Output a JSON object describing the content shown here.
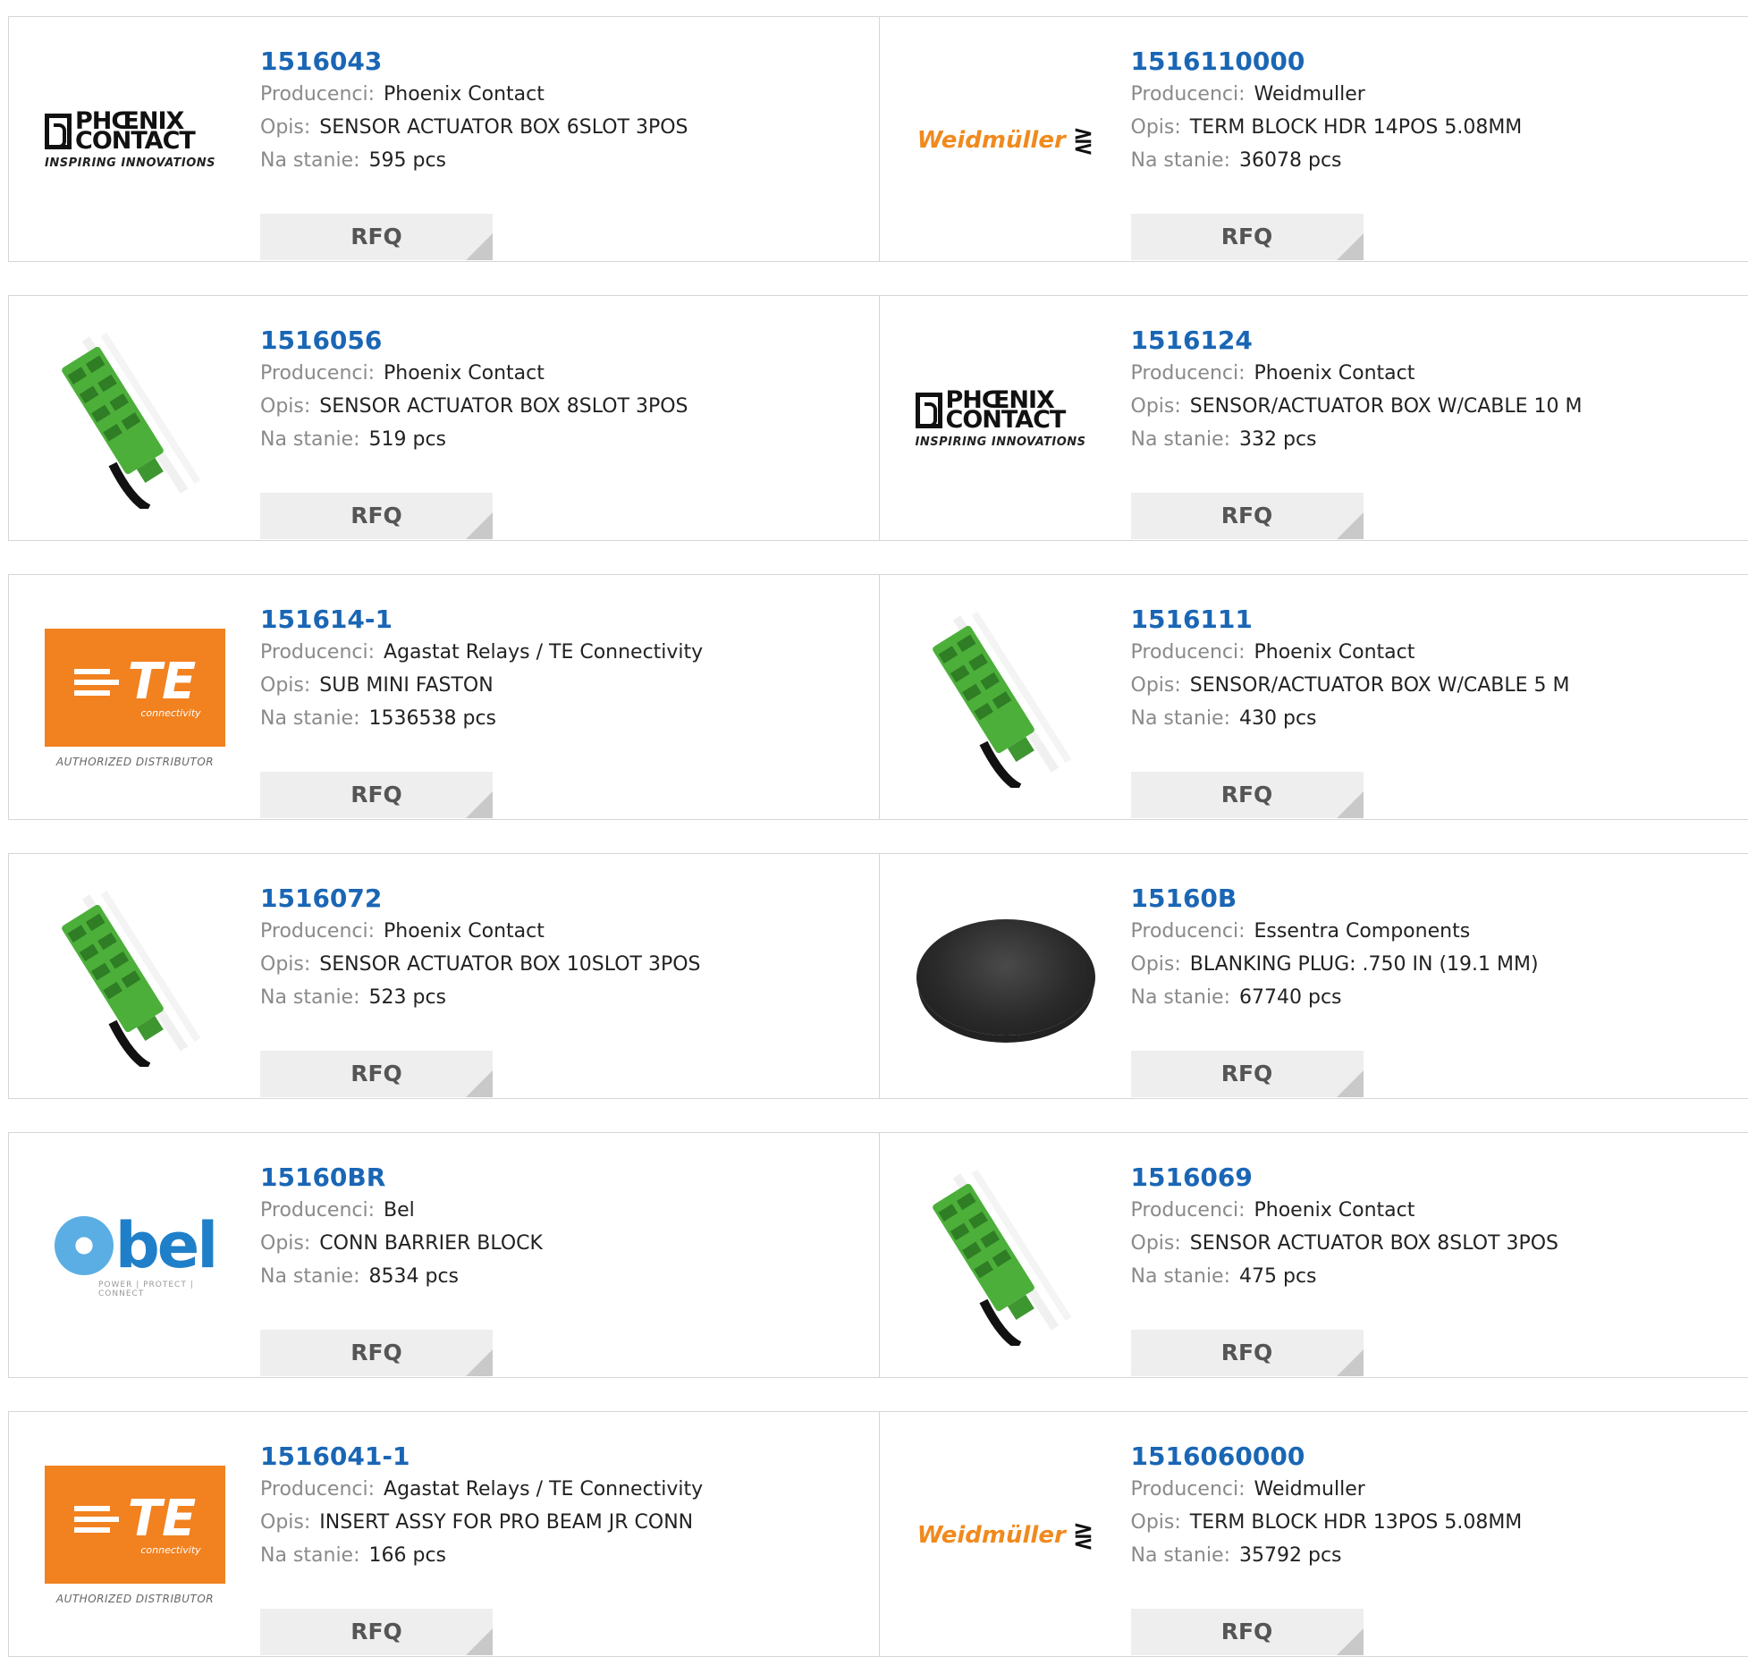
{
  "labels": {
    "manufacturer": "Producenci:",
    "description": "Opis:",
    "stock": "Na stanie:",
    "rfq": "RFQ"
  },
  "products": [
    {
      "part": "1516043",
      "manufacturer": "Phoenix Contact",
      "description": "SENSOR ACTUATOR BOX 6SLOT 3POS",
      "stock": "595 pcs",
      "logo": "phoenix-contact-logo"
    },
    {
      "part": "1516110000",
      "manufacturer": "Weidmuller",
      "description": "TERM BLOCK HDR 14POS 5.08MM",
      "stock": "36078 pcs",
      "logo": "weidmuller-logo"
    },
    {
      "part": "1516056",
      "manufacturer": "Phoenix Contact",
      "description": "SENSOR ACTUATOR BOX 8SLOT 3POS",
      "stock": "519 pcs",
      "logo": "sensor-box-photo"
    },
    {
      "part": "1516124",
      "manufacturer": "Phoenix Contact",
      "description": "SENSOR/ACTUATOR BOX W/CABLE 10 M",
      "stock": "332 pcs",
      "logo": "phoenix-contact-logo"
    },
    {
      "part": "151614-1",
      "manufacturer": "Agastat Relays / TE Connectivity",
      "description": "SUB MINI FASTON",
      "stock": "1536538 pcs",
      "logo": "te-connectivity-logo"
    },
    {
      "part": "1516111",
      "manufacturer": "Phoenix Contact",
      "description": "SENSOR/ACTUATOR BOX W/CABLE 5 M",
      "stock": "430 pcs",
      "logo": "sensor-box-photo"
    },
    {
      "part": "1516072",
      "manufacturer": "Phoenix Contact",
      "description": "SENSOR ACTUATOR BOX 10SLOT 3POS",
      "stock": "523 pcs",
      "logo": "sensor-box-photo"
    },
    {
      "part": "15160B",
      "manufacturer": "Essentra Components",
      "description": "BLANKING PLUG: .750 IN (19.1 MM)",
      "stock": "67740 pcs",
      "logo": "blanking-plug-photo"
    },
    {
      "part": "15160BR",
      "manufacturer": "Bel",
      "description": "CONN BARRIER BLOCK",
      "stock": "8534 pcs",
      "logo": "bel-logo"
    },
    {
      "part": "1516069",
      "manufacturer": "Phoenix Contact",
      "description": "SENSOR ACTUATOR BOX 8SLOT 3POS",
      "stock": "475 pcs",
      "logo": "sensor-box-photo"
    },
    {
      "part": "1516041-1",
      "manufacturer": "Agastat Relays / TE Connectivity",
      "description": "INSERT ASSY FOR PRO BEAM JR CONN",
      "stock": "166 pcs",
      "logo": "te-connectivity-logo"
    },
    {
      "part": "1516060000",
      "manufacturer": "Weidmuller",
      "description": "TERM BLOCK HDR 13POS 5.08MM",
      "stock": "35792 pcs",
      "logo": "weidmuller-logo"
    }
  ],
  "logos": {
    "phoenix": {
      "line1": "PHŒNIX",
      "line2": "CONTACT",
      "tagline": "INSPIRING INNOVATIONS"
    },
    "weidmuller": {
      "text": "Weidmüller",
      "symbol": "⋛"
    },
    "te": {
      "text": "TE",
      "sub": "connectivity",
      "tagline": "AUTHORIZED DISTRIBUTOR"
    },
    "bel": {
      "text": "bel",
      "tagline": "POWER | PROTECT | CONNECT"
    }
  },
  "colors": {
    "part_link": "#1a66b5",
    "label_gray": "#8a8a8a",
    "rfq_bg": "#eeeeee",
    "te_orange": "#f2811f",
    "weidmuller_orange": "#f08a1e",
    "bel_blue": "#1f7fc9",
    "connector_green": "#4caf3a"
  }
}
